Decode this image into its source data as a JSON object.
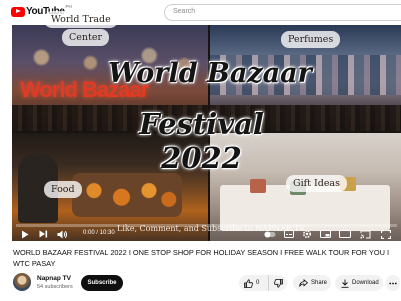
{
  "header": {
    "logo_text": "YouTube",
    "logo_country": "PH",
    "search_placeholder": "Search"
  },
  "video": {
    "overlay_title_line1": "World Bazaar",
    "overlay_title_line2": "Festival 2022",
    "tile_labels": {
      "world_trade_line1": "World Trade",
      "world_trade_line2": "Center",
      "perfumes": "Perfumes",
      "food": "Food",
      "gift_ideas": "Gift Ideas"
    },
    "caption": "Like, Comment, and Subscribe to NAPNAP TV",
    "time_display": "0:00 / 10:30",
    "progress": 0
  },
  "title": "WORLD BAZAAR FESTIVAL 2022 I ONE STOP SHOP FOR HOLIDAY SEASON I FREE WALK TOUR FOR YOU I WTC PASAY",
  "channel": {
    "name": "Napnap TV",
    "subscribers": "54 subscribers",
    "subscribe_label": "Subscribe"
  },
  "actions": {
    "like_count": "0",
    "share_label": "Share",
    "download_label": "Download"
  },
  "colors": {
    "brand_red": "#ff0000",
    "subscribe_bg": "#0f0f0f",
    "chip_bg": "#f2f2f2"
  }
}
